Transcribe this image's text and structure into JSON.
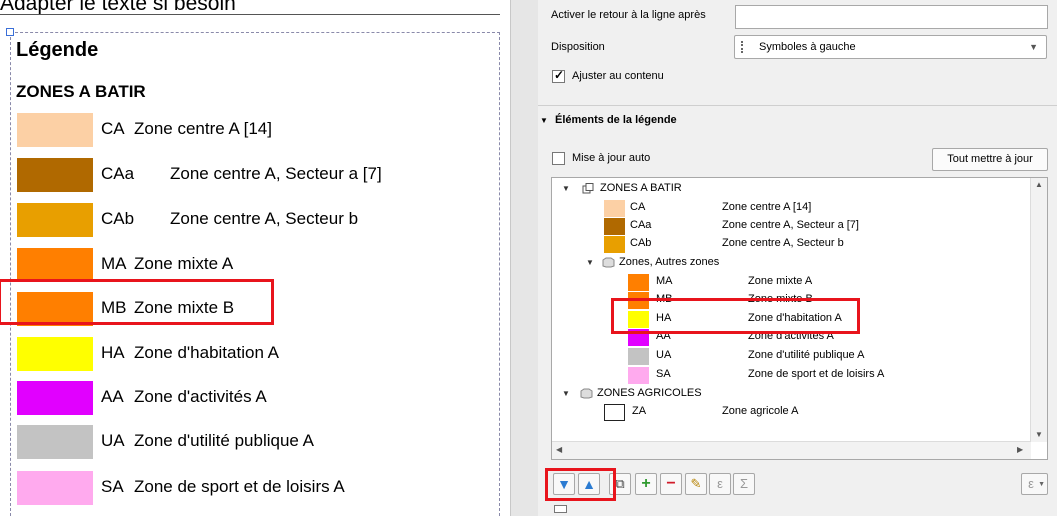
{
  "left": {
    "top_text": "Adapter le texte si besoin",
    "legend_title": "Légende",
    "group_title": "ZONES A BATIR",
    "items": [
      {
        "code": "CA",
        "name": "Zone centre A [14]",
        "color": "#fcd0a5"
      },
      {
        "code": "CAa",
        "name": "Zone centre A, Secteur a [7]",
        "color": "#b06900"
      },
      {
        "code": "CAb",
        "name": "Zone centre A, Secteur b",
        "color": "#e89f00"
      },
      {
        "code": "MA",
        "name": "Zone mixte A",
        "color": "#ff7f00"
      },
      {
        "code": "MB",
        "name": "Zone mixte B",
        "color": "#ff7f00"
      },
      {
        "code": "HA",
        "name": "Zone d'habitation A",
        "color": "#ffff00"
      },
      {
        "code": "AA",
        "name": "Zone d'activités A",
        "color": "#e100ff"
      },
      {
        "code": "UA",
        "name": "Zone d'utilité publique A",
        "color": "#c3c3c3"
      },
      {
        "code": "SA",
        "name": "Zone de sport et de loisirs A",
        "color": "#ffaaee"
      }
    ]
  },
  "panel": {
    "wrap_label": "Activer le retour à la ligne après",
    "wrap_value": "",
    "disposition_label": "Disposition",
    "disposition_value": "Symboles à gauche",
    "fit_label": "Ajuster au contenu",
    "fit_checked": true,
    "section_title": "Éléments de la légende",
    "auto_update_label": "Mise à jour auto",
    "auto_update_checked": false,
    "update_all_button": "Tout mettre à jour",
    "tree": {
      "group1": "ZONES A BATIR",
      "group1_items": [
        {
          "code": "CA",
          "name": "Zone centre A [14]",
          "color": "#fcd0a5"
        },
        {
          "code": "CAa",
          "name": "Zone centre A, Secteur a [7]",
          "color": "#b06900"
        },
        {
          "code": "CAb",
          "name": "Zone centre A, Secteur b",
          "color": "#e89f00"
        }
      ],
      "subgroup": "Zones, Autres zones",
      "subgroup_items": [
        {
          "code": "MA",
          "name": "Zone mixte A",
          "color": "#ff7f00"
        },
        {
          "code": "MB",
          "name": "Zone mixte B",
          "color": "#ff7f00"
        },
        {
          "code": "HA",
          "name": "Zone d'habitation A",
          "color": "#ffff00"
        },
        {
          "code": "AA",
          "name": "Zone d'activités A",
          "color": "#e100ff"
        },
        {
          "code": "UA",
          "name": "Zone d'utilité publique A",
          "color": "#c3c3c3"
        },
        {
          "code": "SA",
          "name": "Zone de sport et de loisirs A",
          "color": "#ffaaee"
        }
      ],
      "group2": "ZONES AGRICOLES",
      "group2_items": [
        {
          "code": "ZA",
          "name": "Zone agricole A",
          "color": "#ffffff"
        }
      ]
    },
    "toolbar_icons": [
      "move-down-icon",
      "move-up-icon",
      "add-group-icon",
      "add-item-icon",
      "remove-item-icon",
      "edit-item-icon",
      "expression-icon",
      "sum-icon",
      "filter-expression-icon"
    ]
  },
  "colors": {
    "highlight": "#e8141c",
    "frame": "#8a8aaa",
    "panel_bg": "#f0f0f0"
  }
}
